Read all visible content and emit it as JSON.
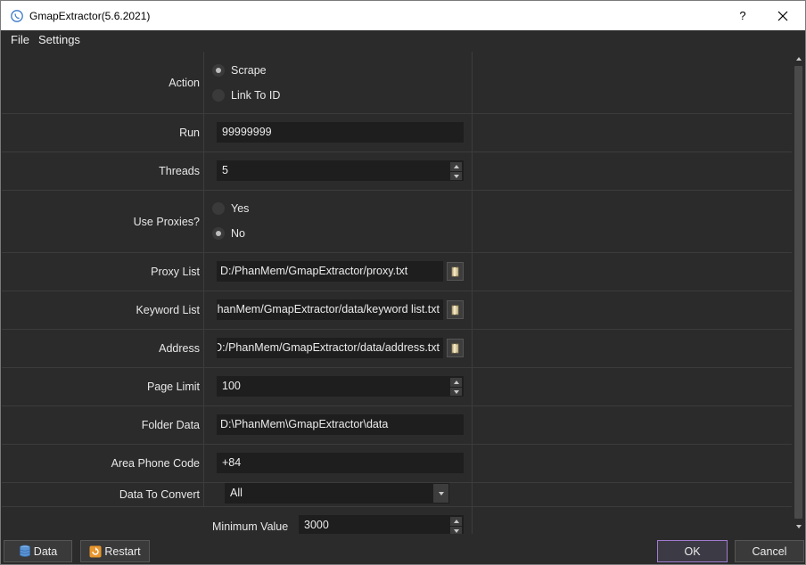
{
  "window": {
    "title": "GmapExtractor(5.6.2021)",
    "help_label": "?",
    "app_icon": "phone-icon",
    "close_icon": "close-icon"
  },
  "menu": {
    "items": [
      {
        "label": "File"
      },
      {
        "label": "Settings"
      }
    ]
  },
  "form": {
    "action": {
      "label": "Action",
      "options": [
        {
          "label": "Scrape",
          "checked": true
        },
        {
          "label": "Link To ID",
          "checked": false
        }
      ]
    },
    "run": {
      "label": "Run",
      "value": "99999999"
    },
    "threads": {
      "label": "Threads",
      "value": "5"
    },
    "use_proxies": {
      "label": "Use Proxies?",
      "options": [
        {
          "label": "Yes",
          "checked": false
        },
        {
          "label": "No",
          "checked": true
        }
      ]
    },
    "proxy_list": {
      "label": "Proxy List",
      "value": "D:/PhanMem/GmapExtractor/proxy.txt"
    },
    "keyword_list": {
      "label": "Keyword List",
      "value": "D:/PhanMem/GmapExtractor/data/keyword list.txt"
    },
    "address": {
      "label": "Address",
      "value": "D:/PhanMem/GmapExtractor/data/address.txt"
    },
    "page_limit": {
      "label": "Page Limit",
      "value": "100"
    },
    "folder_data": {
      "label": "Folder Data",
      "value": "D:\\PhanMem\\GmapExtractor\\data"
    },
    "area_phone_code": {
      "label": "Area Phone Code",
      "value": "+84"
    },
    "data_to_convert": {
      "label": "Data To Convert",
      "value": "All"
    },
    "minimum_value": {
      "label": "Minimum Value",
      "value": "3000"
    }
  },
  "buttons": {
    "data": "Data",
    "restart": "Restart",
    "ok": "OK",
    "cancel": "Cancel"
  },
  "colors": {
    "background": "#2b2b2b",
    "field": "#1e1e1e",
    "ok_border": "#a07bd0",
    "text": "#e8e8e8"
  }
}
